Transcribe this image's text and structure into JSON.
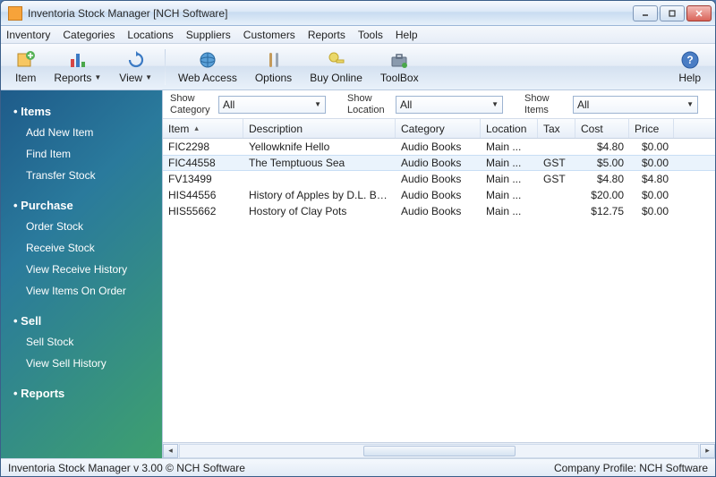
{
  "window": {
    "title": "Inventoria Stock Manager [NCH Software]"
  },
  "menu": [
    "Inventory",
    "Categories",
    "Locations",
    "Suppliers",
    "Customers",
    "Reports",
    "Tools",
    "Help"
  ],
  "toolbar": {
    "item": "Item",
    "reports": "Reports",
    "view": "View",
    "web": "Web Access",
    "options": "Options",
    "buy": "Buy Online",
    "toolbox": "ToolBox",
    "help": "Help"
  },
  "filters": {
    "category_label": "Show Category",
    "category_value": "All",
    "location_label": "Show Location",
    "location_value": "All",
    "items_label": "Show Items",
    "items_value": "All"
  },
  "columns": {
    "item": "Item",
    "desc": "Description",
    "cat": "Category",
    "loc": "Location",
    "tax": "Tax",
    "cost": "Cost",
    "price": "Price"
  },
  "rows": [
    {
      "item": "FIC2298",
      "desc": "Yellowknife Hello",
      "cat": "Audio Books",
      "loc": "Main ...",
      "tax": "",
      "cost": "$4.80",
      "price": "$0.00"
    },
    {
      "item": "FIC44558",
      "desc": "The Temptuous Sea",
      "cat": "Audio Books",
      "loc": "Main ...",
      "tax": "GST",
      "cost": "$5.00",
      "price": "$0.00"
    },
    {
      "item": "FV13499",
      "desc": "",
      "cat": "Audio Books",
      "loc": "Main ...",
      "tax": "GST",
      "cost": "$4.80",
      "price": "$4.80"
    },
    {
      "item": "HIS44556",
      "desc": "History of Apples by D.L. Brewer",
      "cat": "Audio Books",
      "loc": "Main ...",
      "tax": "",
      "cost": "$20.00",
      "price": "$0.00"
    },
    {
      "item": "HIS55662",
      "desc": "Hostory of Clay Pots",
      "cat": "Audio Books",
      "loc": "Main ...",
      "tax": "",
      "cost": "$12.75",
      "price": "$0.00"
    }
  ],
  "sidebar": {
    "groups": [
      {
        "head": "Items",
        "items": [
          "Add New Item",
          "Find Item",
          "Transfer Stock"
        ]
      },
      {
        "head": "Purchase",
        "items": [
          "Order Stock",
          "Receive Stock",
          "View Receive History",
          "View Items On Order"
        ]
      },
      {
        "head": "Sell",
        "items": [
          "Sell Stock",
          "View Sell History"
        ]
      },
      {
        "head": "Reports",
        "items": []
      }
    ]
  },
  "status": {
    "left": "Inventoria Stock Manager v 3.00 © NCH Software",
    "right": "Company Profile: NCH Software"
  }
}
